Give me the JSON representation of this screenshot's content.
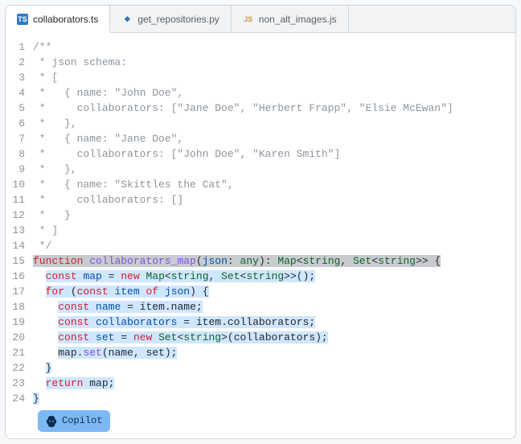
{
  "tabs": [
    {
      "label": "collaborators.ts",
      "icon": "ts",
      "active": true
    },
    {
      "label": "get_repositories.py",
      "icon": "py",
      "active": false
    },
    {
      "label": "non_alt_images.js",
      "icon": "js",
      "active": false
    }
  ],
  "copilot_label": "Copilot",
  "code_lines": [
    {
      "n": 1,
      "hl": "none",
      "tokens": [
        [
          "cmt",
          "/**"
        ]
      ]
    },
    {
      "n": 2,
      "hl": "none",
      "tokens": [
        [
          "cmt",
          " * json schema:"
        ]
      ]
    },
    {
      "n": 3,
      "hl": "none",
      "tokens": [
        [
          "cmt",
          " * ["
        ]
      ]
    },
    {
      "n": 4,
      "hl": "none",
      "tokens": [
        [
          "cmt",
          " *   { name: \"John Doe\","
        ]
      ]
    },
    {
      "n": 5,
      "hl": "none",
      "tokens": [
        [
          "cmt",
          " *     collaborators: [\"Jane Doe\", \"Herbert Frapp\", \"Elsie McEwan\"]"
        ]
      ]
    },
    {
      "n": 6,
      "hl": "none",
      "tokens": [
        [
          "cmt",
          " *   },"
        ]
      ]
    },
    {
      "n": 7,
      "hl": "none",
      "tokens": [
        [
          "cmt",
          " *   { name: \"Jane Doe\","
        ]
      ]
    },
    {
      "n": 8,
      "hl": "none",
      "tokens": [
        [
          "cmt",
          " *     collaborators: [\"John Doe\", \"Karen Smith\"]"
        ]
      ]
    },
    {
      "n": 9,
      "hl": "none",
      "tokens": [
        [
          "cmt",
          " *   },"
        ]
      ]
    },
    {
      "n": 10,
      "hl": "none",
      "tokens": [
        [
          "cmt",
          " *   { name: \"Skittles the Cat\","
        ]
      ]
    },
    {
      "n": 11,
      "hl": "none",
      "tokens": [
        [
          "cmt",
          " *     collaborators: []"
        ]
      ]
    },
    {
      "n": 12,
      "hl": "none",
      "tokens": [
        [
          "cmt",
          " *   }"
        ]
      ]
    },
    {
      "n": 13,
      "hl": "none",
      "tokens": [
        [
          "cmt",
          " * ]"
        ]
      ]
    },
    {
      "n": 14,
      "hl": "none",
      "tokens": [
        [
          "cmt",
          " */"
        ]
      ]
    },
    {
      "n": 15,
      "hl": "grey",
      "tokens": [
        [
          "kw",
          "function"
        ],
        [
          "",
          " "
        ],
        [
          "fn",
          "collaborators_map"
        ],
        [
          "",
          "("
        ],
        [
          "prop",
          "json"
        ],
        [
          "",
          ": "
        ],
        [
          "type",
          "any"
        ],
        [
          "",
          "): "
        ],
        [
          "type",
          "Map"
        ],
        [
          "",
          "<"
        ],
        [
          "type",
          "string"
        ],
        [
          "",
          ", "
        ],
        [
          "type",
          "Set"
        ],
        [
          "",
          "<"
        ],
        [
          "type",
          "string"
        ],
        [
          "",
          ">> {"
        ]
      ]
    },
    {
      "n": 16,
      "hl": "blue",
      "indent": "  ",
      "tokens": [
        [
          "kw",
          "const"
        ],
        [
          "",
          " "
        ],
        [
          "prop",
          "map"
        ],
        [
          "",
          " = "
        ],
        [
          "kw",
          "new"
        ],
        [
          "",
          " "
        ],
        [
          "type",
          "Map"
        ],
        [
          "",
          "<"
        ],
        [
          "type",
          "string"
        ],
        [
          "",
          ", "
        ],
        [
          "type",
          "Set"
        ],
        [
          "",
          "<"
        ],
        [
          "type",
          "string"
        ],
        [
          "",
          ">>();"
        ]
      ]
    },
    {
      "n": 17,
      "hl": "blue",
      "indent": "  ",
      "tokens": [
        [
          "kw",
          "for"
        ],
        [
          "",
          " ("
        ],
        [
          "kw",
          "const"
        ],
        [
          "",
          " "
        ],
        [
          "prop",
          "item"
        ],
        [
          "",
          " "
        ],
        [
          "kw",
          "of"
        ],
        [
          "",
          " "
        ],
        [
          "prop",
          "json"
        ],
        [
          "",
          ") {"
        ]
      ]
    },
    {
      "n": 18,
      "hl": "blue",
      "indent": "    ",
      "tokens": [
        [
          "kw",
          "const"
        ],
        [
          "",
          " "
        ],
        [
          "prop",
          "name"
        ],
        [
          "",
          " = item.name;"
        ]
      ]
    },
    {
      "n": 19,
      "hl": "blue",
      "indent": "    ",
      "tokens": [
        [
          "kw",
          "const"
        ],
        [
          "",
          " "
        ],
        [
          "prop",
          "collaborators"
        ],
        [
          "",
          " = item.collaborators;"
        ]
      ]
    },
    {
      "n": 20,
      "hl": "blue",
      "indent": "    ",
      "tokens": [
        [
          "kw",
          "const"
        ],
        [
          "",
          " "
        ],
        [
          "prop",
          "set"
        ],
        [
          "",
          " = "
        ],
        [
          "kw",
          "new"
        ],
        [
          "",
          " "
        ],
        [
          "type",
          "Set"
        ],
        [
          "",
          "<"
        ],
        [
          "type",
          "string"
        ],
        [
          "",
          ">(collaborators);"
        ]
      ]
    },
    {
      "n": 21,
      "hl": "blue",
      "indent": "    ",
      "tokens": [
        [
          "",
          "map."
        ],
        [
          "fn",
          "set"
        ],
        [
          "",
          "(name, set);"
        ]
      ]
    },
    {
      "n": 22,
      "hl": "blue",
      "indent": "  ",
      "tokens": [
        [
          "",
          "}"
        ]
      ]
    },
    {
      "n": 23,
      "hl": "blue",
      "indent": "  ",
      "tokens": [
        [
          "kw",
          "return"
        ],
        [
          "",
          " map;"
        ]
      ]
    },
    {
      "n": 24,
      "hl": "blue",
      "tokens": [
        [
          "",
          "}"
        ]
      ]
    }
  ]
}
